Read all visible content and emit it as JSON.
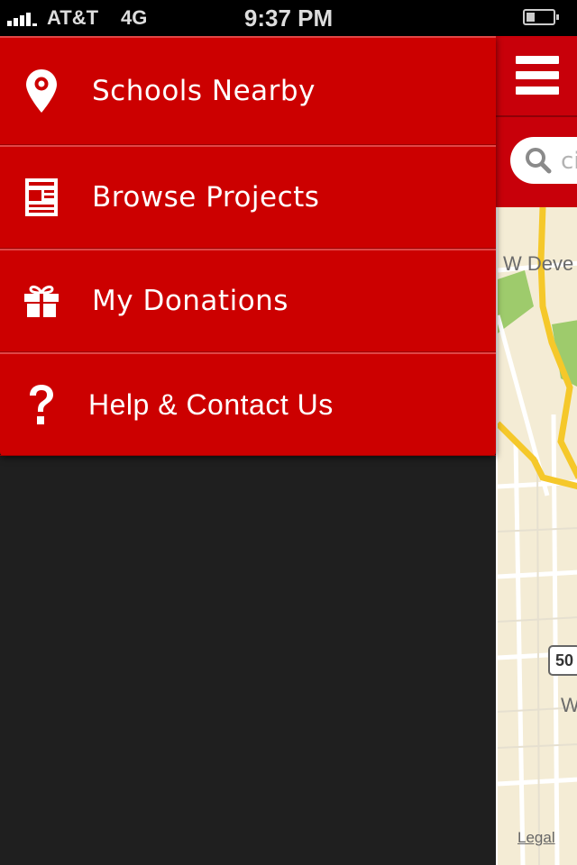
{
  "status_bar": {
    "carrier": "AT&T",
    "network": "4G",
    "time": "9:37 PM"
  },
  "menu": {
    "items": [
      {
        "label": "Schools Nearby",
        "icon": "map-pin-icon"
      },
      {
        "label": "Browse Projects",
        "icon": "newspaper-icon"
      },
      {
        "label": "My Donations",
        "icon": "gift-icon"
      },
      {
        "label": "Help & Contact Us",
        "icon": "question-mark-icon"
      }
    ]
  },
  "map": {
    "search_placeholder": "ci",
    "street_label_1": "W Deve",
    "street_label_2": "W",
    "route_shield": "50",
    "legal_link": "Legal"
  },
  "colors": {
    "brand_red": "#cc0000",
    "map_background": "#f4ecd5",
    "highway": "#f5c82a"
  }
}
